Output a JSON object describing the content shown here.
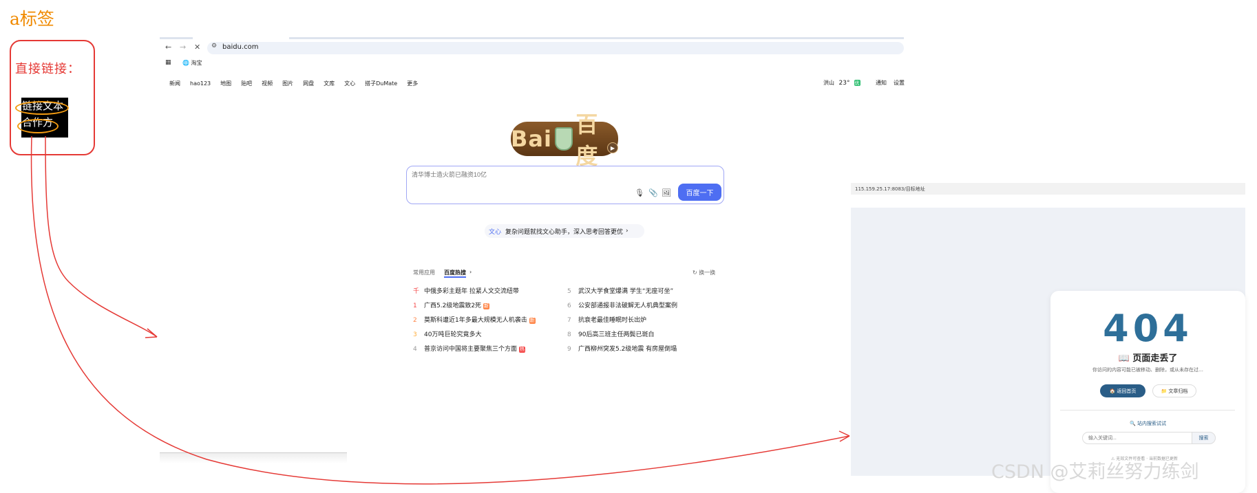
{
  "annotation": {
    "title": "a标签",
    "label": "直接链接：",
    "links": [
      "链接文本",
      "合作方"
    ],
    "colors": {
      "title": "#f08a00",
      "box": "#e53935",
      "oval": "#f39c12"
    }
  },
  "browser": {
    "nav_icons": [
      "back-icon",
      "forward-icon",
      "close-icon",
      "site-settings-icon"
    ],
    "url": "baidu.com",
    "bookmarks": {
      "app_icon": "apps-grid-icon",
      "item": "淘宝"
    }
  },
  "baidu": {
    "topnav": [
      "新闻",
      "hao123",
      "地图",
      "贴吧",
      "视频",
      "图片",
      "网盘",
      "文库",
      "文心",
      "搭子DuMate",
      "更多"
    ],
    "weather": {
      "city": "洪山",
      "temp": "23°",
      "aqi": "优"
    },
    "top_right": [
      "通知",
      "设置"
    ],
    "logo_text": "Bai",
    "logo_text2": "百度",
    "search_placeholder": "清华博士造火箭已融资10亿",
    "search_button": "百度一下",
    "wenxin_brand": "文心",
    "wenxin_text": "复杂问题就找文心助手，深入思考回答更优",
    "tabs": {
      "common": "常用应用",
      "hot": "百度热搜",
      "refresh": "换一换"
    },
    "hot_left": [
      {
        "n": "千",
        "t": "中俄多彩主题年 拉紧人文交流纽带",
        "badge": ""
      },
      {
        "n": "1",
        "t": "广西5.2级地震致2死",
        "badge": "新"
      },
      {
        "n": "2",
        "t": "莫斯科遭近1年多最大规模无人机袭击",
        "badge": "新"
      },
      {
        "n": "3",
        "t": "40万吨巨轮究竟多大",
        "badge": ""
      },
      {
        "n": "4",
        "t": "普京访问中国将主要聚焦三个方面",
        "badge": "热"
      }
    ],
    "hot_right": [
      {
        "n": "5",
        "t": "武汉大学食堂爆满 学生“无座可坐”"
      },
      {
        "n": "6",
        "t": "公安部通报非法破解无人机典型案例"
      },
      {
        "n": "7",
        "t": "抗衰老最佳睡眠时长出炉"
      },
      {
        "n": "8",
        "t": "90后高三班主任两鬓已斑白"
      },
      {
        "n": "9",
        "t": "广西柳州突发5.2级地震 有房屋倒塌"
      }
    ]
  },
  "page404": {
    "url": "115.159.25.17:8083/目标地址",
    "code": "404",
    "title": "📖 页面走丢了",
    "subtitle": "你访问的内容可能已被移动、删除，或从未存在过…",
    "home_button": "🏠 返回首页",
    "back_button": "📁 文章归档",
    "site_search": "🔍 站内搜索试试",
    "search_placeholder": "输入关键词...",
    "search_button": "搜索",
    "footer": "⚠ 无效文件可查看 · 当前数据已更新"
  },
  "watermark": "CSDN @艾莉丝努力练剑"
}
